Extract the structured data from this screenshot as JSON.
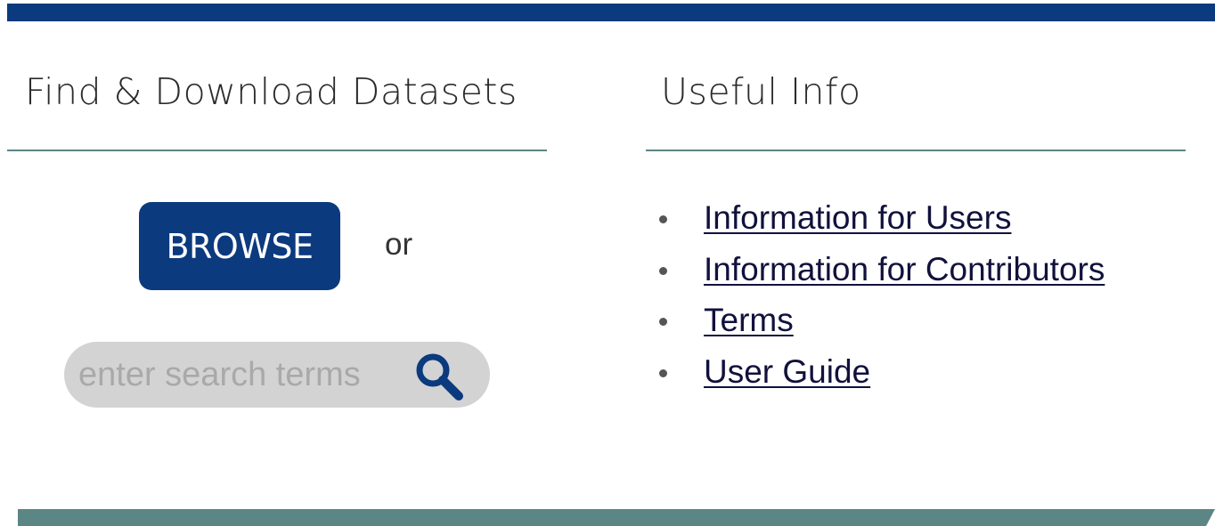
{
  "left_panel": {
    "heading": "Find & Download Datasets",
    "browse_label": "BROWSE",
    "or_text": "or",
    "search_placeholder": "enter search terms",
    "search_icon": "magnifier-icon"
  },
  "right_panel": {
    "heading": "Useful Info",
    "links": [
      {
        "label": "Information for Users"
      },
      {
        "label": "Information for Contributors"
      },
      {
        "label": "Terms"
      },
      {
        "label": "User Guide"
      }
    ]
  },
  "colors": {
    "brand_navy": "#0b3a7e",
    "teal_accent": "#5c8585",
    "search_bg": "#d3d3d3",
    "link_text": "#11113d"
  }
}
